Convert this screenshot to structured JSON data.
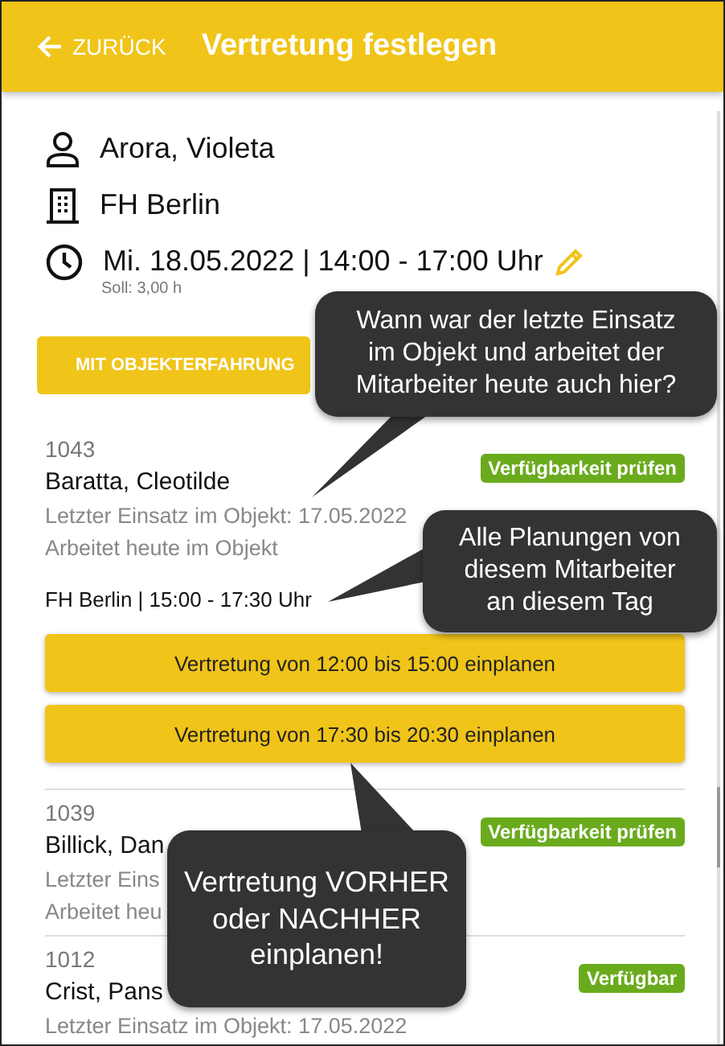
{
  "header": {
    "back_label": "ZURÜCK",
    "title": "Vertretung festlegen"
  },
  "shift": {
    "employee": "Arora, Violeta",
    "location": "FH Berlin",
    "datetime": "Mi. 18.05.2022 | 14:00 - 17:00 Uhr",
    "target": "Soll: 3,00 h"
  },
  "filter_button": "MIT OBJEKTERFAHRUNG",
  "candidates": [
    {
      "number": "1043",
      "name": "Baratta, Cleotilde",
      "badge": "Verfügbarkeit prüfen",
      "details": [
        "Letzter Einsatz im Objekt: 17.05.2022",
        "Arbeitet heute im Objekt"
      ],
      "plannings": [
        "FH Berlin | 15:00 - 17:30 Uhr"
      ],
      "actions": [
        "Vertretung von 12:00 bis 15:00 einplanen",
        "Vertretung von 17:30 bis 20:30 einplanen"
      ]
    },
    {
      "number": "1039",
      "name": "Billick, Dan",
      "badge": "Verfügbarkeit prüfen",
      "details": [
        "Letzter Eins",
        "Arbeitet heu"
      ]
    },
    {
      "number": "1012",
      "name": "Crist, Pans",
      "badge": "Verfügbar",
      "details": [
        "Letzter Einsatz im Objekt: 17.05.2022"
      ]
    }
  ],
  "callouts": [
    {
      "lines": [
        "Wann war der letzte Einsatz",
        "im Objekt und arbeitet der",
        "Mitarbeiter heute auch hier?"
      ]
    },
    {
      "lines": [
        "Alle Planungen von",
        "diesem Mitarbeiter",
        "an diesem Tag"
      ]
    },
    {
      "lines": [
        "Vertretung VORHER",
        "oder NACHHER",
        "einplanen!"
      ]
    }
  ]
}
